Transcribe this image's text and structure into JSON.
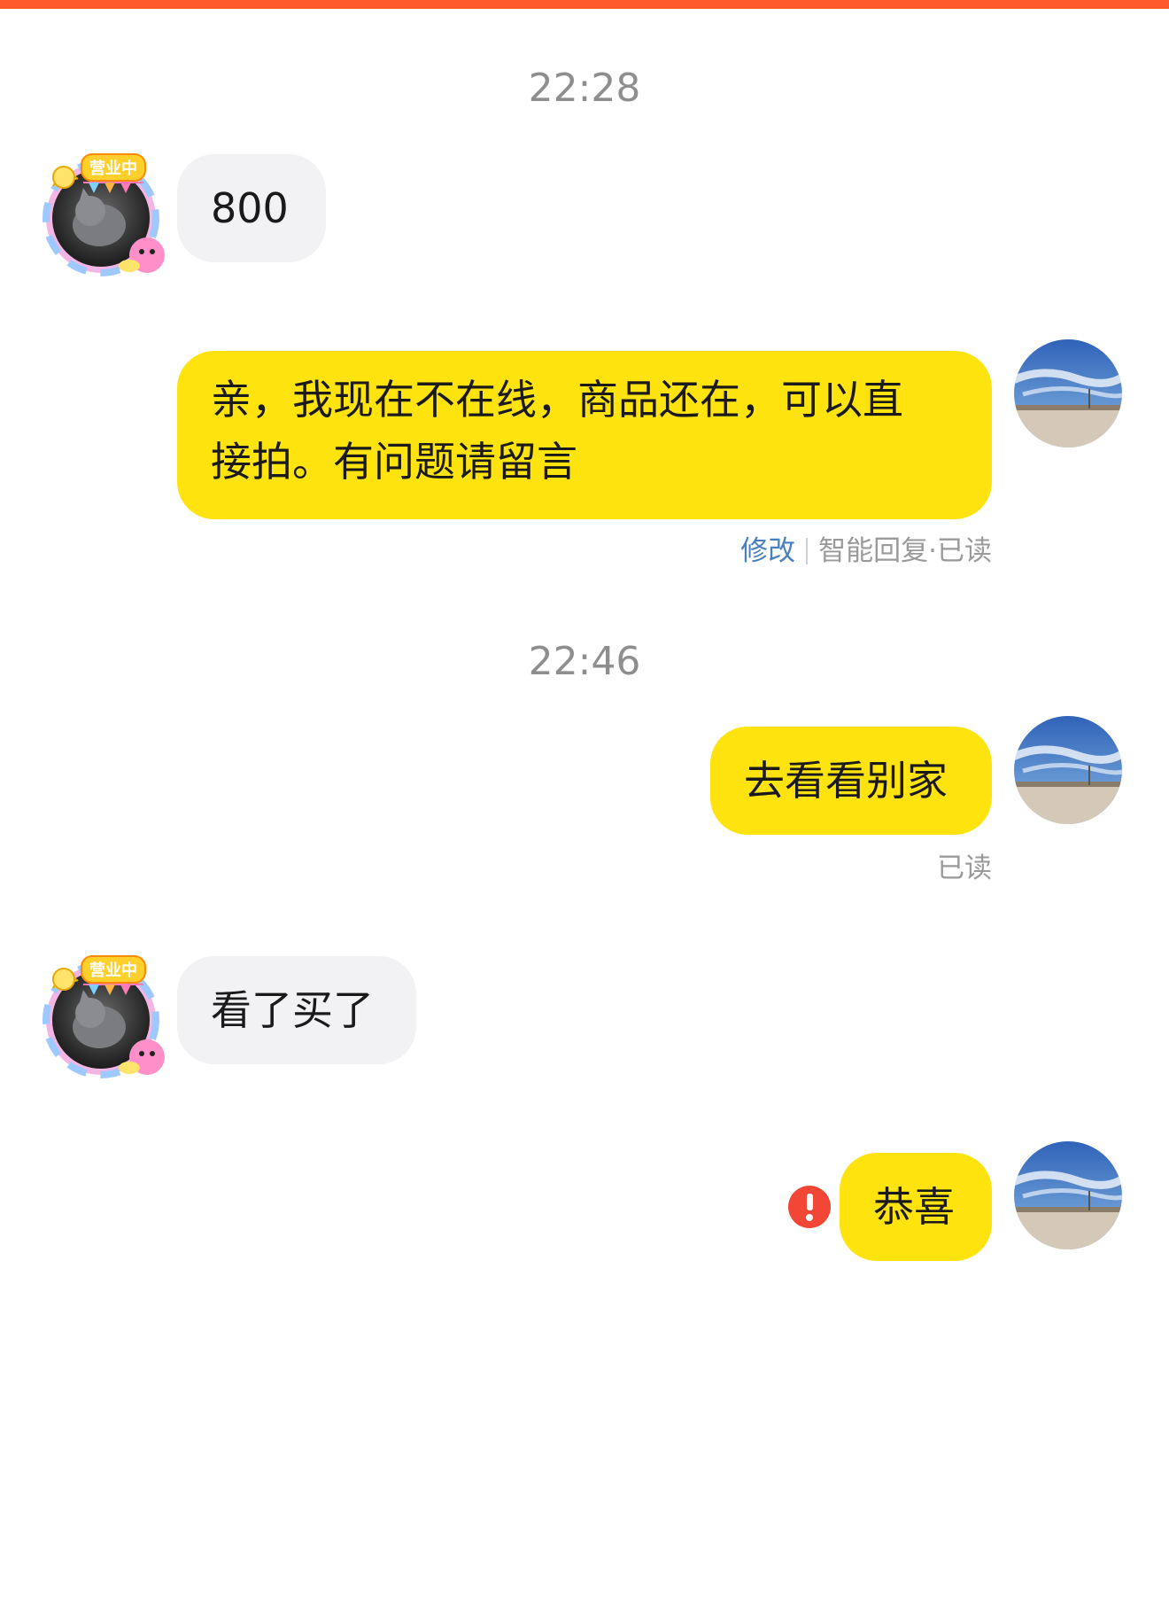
{
  "chat": {
    "timestamps": [
      "22:28",
      "22:46"
    ],
    "msg1": {
      "text": "800"
    },
    "msg2": {
      "lines": [
        "亲，我现在不在线，商品还在，可以直",
        "接拍。有问题请留言"
      ],
      "edit_label": "修改",
      "meta_label": "智能回复·已读"
    },
    "msg3": {
      "text": "去看看别家",
      "read_label": "已读"
    },
    "msg4": {
      "text": "看了买了"
    },
    "msg5": {
      "text": "恭喜"
    },
    "badge_text": "营业中"
  },
  "colors": {
    "accent_bar": "#ff5a2c",
    "outgoing_bubble": "#ffe30f",
    "incoming_bubble": "#f2f2f4",
    "alert": "#f24637",
    "link": "#4a7fbf"
  },
  "icons": {
    "seller_avatar": "cat-avatar-with-festive-frame",
    "my_avatar": "sky-landscape-avatar",
    "send_failed": "exclamation-alert-icon"
  }
}
